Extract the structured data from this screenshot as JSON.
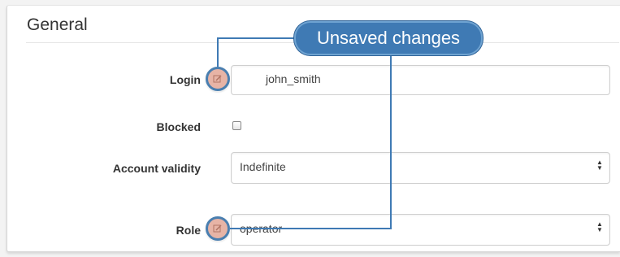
{
  "section": {
    "title": "General"
  },
  "fields": {
    "login": {
      "label": "Login",
      "value": "john_smith"
    },
    "blocked": {
      "label": "Blocked",
      "checked": false
    },
    "account_validity": {
      "label": "Account validity",
      "value": "Indefinite"
    },
    "role": {
      "label": "Role",
      "value": "operator"
    }
  },
  "callout": {
    "text": "Unsaved changes"
  },
  "icons": {
    "unsaved_marker": "edit-icon",
    "select_arrows": "up-down-arrows-icon"
  },
  "colors": {
    "callout": "#3f7ab4",
    "callout_border": "#6fa3d1",
    "marker_fill": "#e7b4a6"
  }
}
